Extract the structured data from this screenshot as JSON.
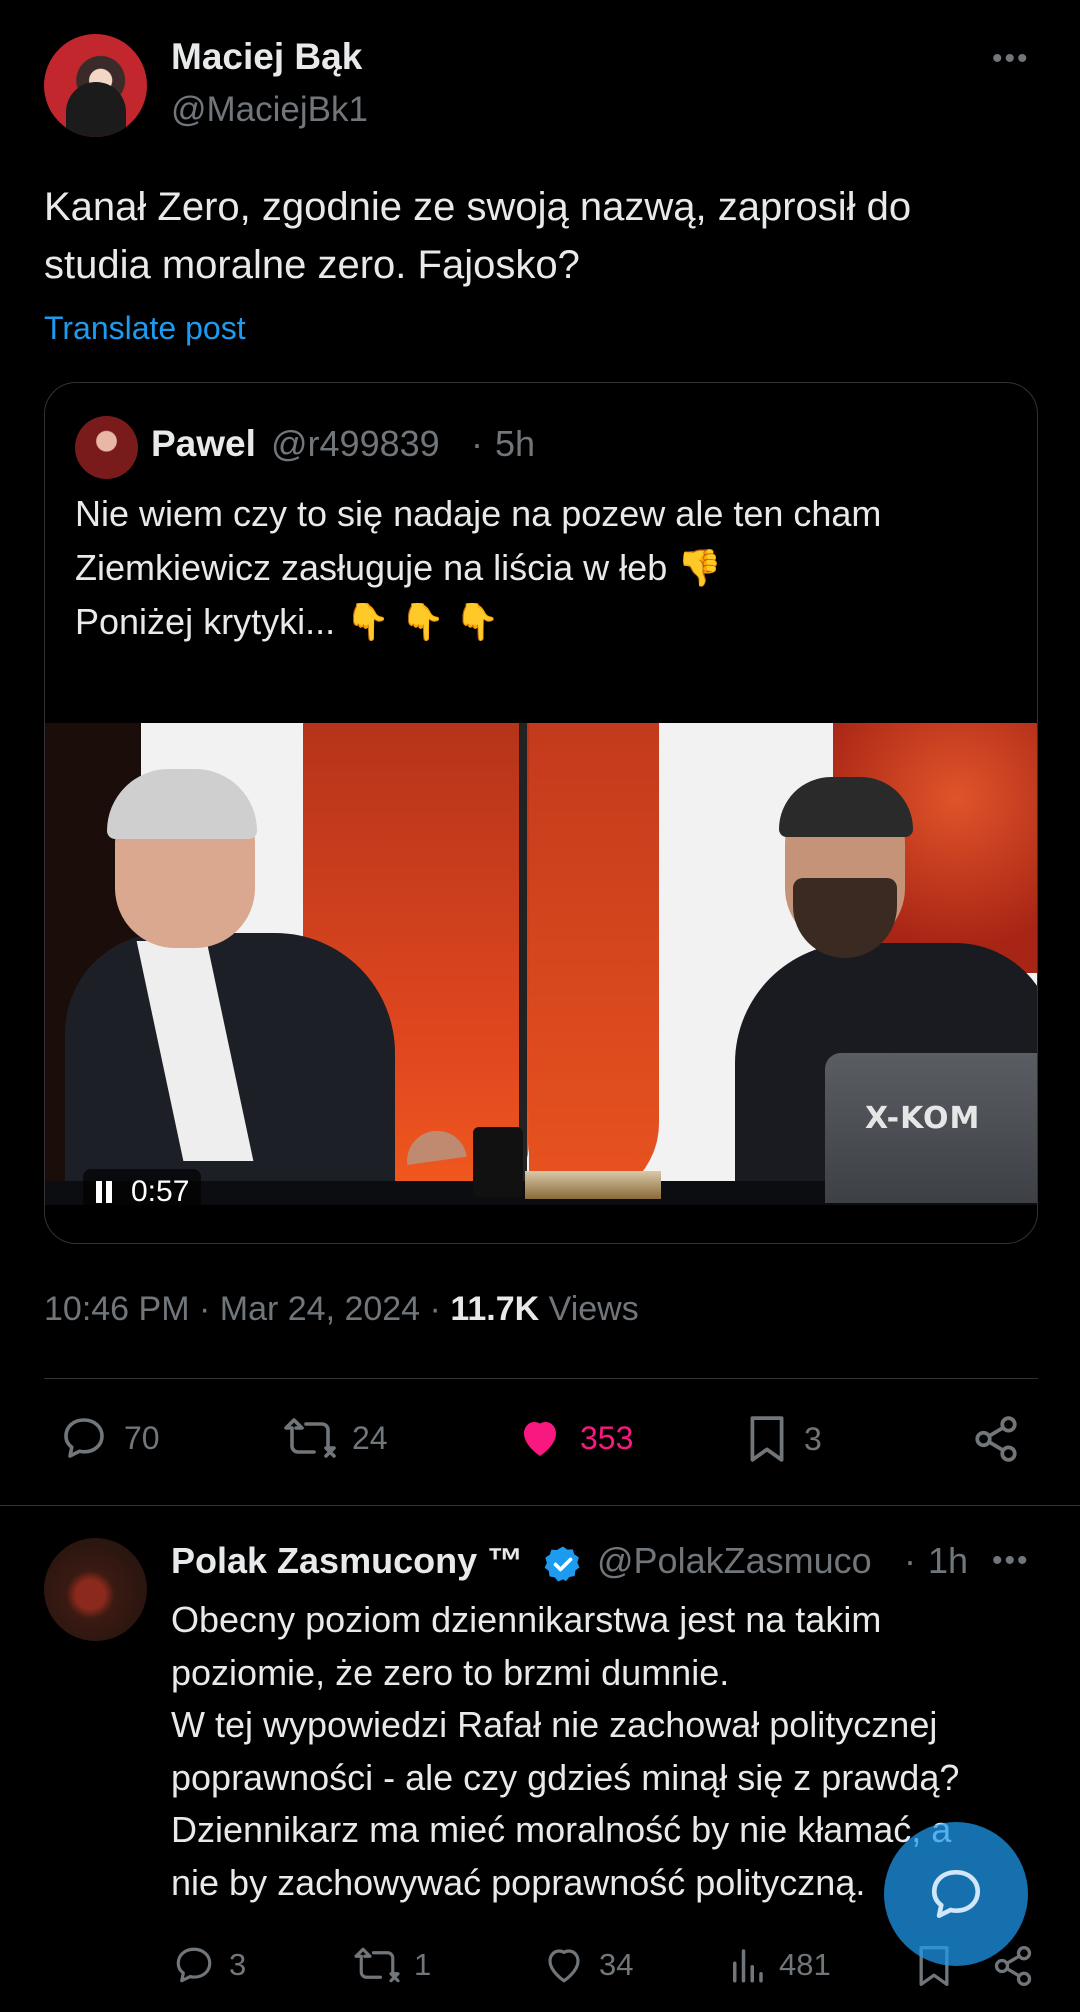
{
  "post": {
    "author_name": "Maciej Bąk",
    "author_handle": "@MaciejBk1",
    "more_icon": "more-horizontal-icon",
    "text_line1": "Kanał Zero, zgodnie ze swoją nazwą, zaprosił do",
    "text_line2": "studia moralne zero. Fajosko?",
    "translate_label": "Translate post",
    "timestamp": "10:46 PM · Mar 24, 2024",
    "separator": "·",
    "views_count": "11.7K",
    "views_label": "Views",
    "actions": {
      "replies": "70",
      "reposts": "24",
      "likes": "353",
      "bookmarks": "3"
    }
  },
  "quote": {
    "author_name": "Pawel",
    "author_handle": "@r499839",
    "separator": "·",
    "time": "5h",
    "line1": "Nie wiem czy to się nadaje na pozew ale ten cham",
    "line2": "Ziemkiewicz zasługuje na liścia w łeb",
    "line3": "Poniżej krytyki...",
    "emoji_thumb": "👎",
    "emoji_point": "👇",
    "video": {
      "duration": "0:57",
      "laptop_logo": "X-KOM"
    }
  },
  "reply": {
    "author_name": "Polak Zasmucony ™",
    "author_handle": "@PolakZasmuco",
    "separator": "·",
    "time": "1h",
    "text_lines": [
      "Obecny poziom dziennikarstwa jest na takim",
      "poziomie, że zero to brzmi dumnie.",
      "W tej wypowiedzi Rafał nie zachował politycznej",
      "poprawności - ale czy gdzieś minął się z prawdą?",
      "Dziennikarz ma mieć moralność by nie kłamać, a",
      "nie by zachowywać poprawność polityczną."
    ],
    "actions": {
      "replies": "3",
      "reposts": "1",
      "likes": "34",
      "views": "481"
    }
  },
  "colors": {
    "background": "#000000",
    "text_primary": "#e7e9ea",
    "text_secondary": "#71767b",
    "accent": "#1d9bf0",
    "like": "#f91880"
  }
}
